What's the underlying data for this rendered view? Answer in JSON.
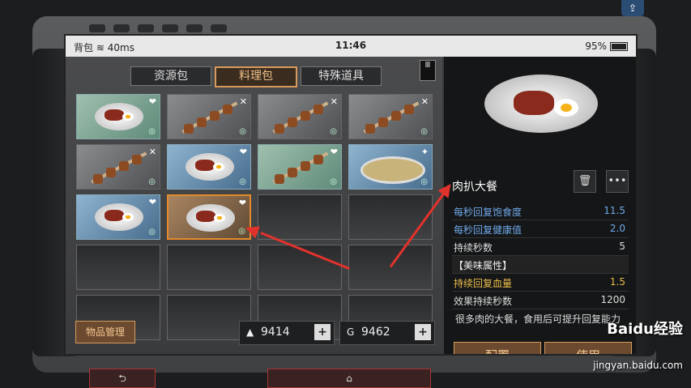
{
  "status": {
    "carrier": "背包",
    "signal": "40ms",
    "time": "11:46",
    "battery": "95%"
  },
  "tabs": [
    {
      "label": "资源包"
    },
    {
      "label": "料理包"
    },
    {
      "label": "特殊道具"
    }
  ],
  "marker": "Ⅲ",
  "slots": [
    {
      "type": "steak",
      "bg": "green",
      "tag": "❤"
    },
    {
      "type": "skewer",
      "bg": "gray",
      "tag": "✕"
    },
    {
      "type": "skewer",
      "bg": "gray",
      "tag": "✕"
    },
    {
      "type": "skewer",
      "bg": "gray",
      "tag": "✕"
    },
    {
      "type": "skewer",
      "bg": "gray",
      "tag": "✕"
    },
    {
      "type": "steak",
      "bg": "blue",
      "tag": "❤"
    },
    {
      "type": "skewer",
      "bg": "green",
      "tag": "❤"
    },
    {
      "type": "fish",
      "bg": "blue",
      "tag": "✦"
    },
    {
      "type": "steak",
      "bg": "blue",
      "tag": "❤"
    },
    {
      "type": "steak",
      "bg": "orange",
      "tag": "❤"
    },
    {
      "type": "empty"
    },
    {
      "type": "empty"
    },
    {
      "type": "empty"
    },
    {
      "type": "empty"
    },
    {
      "type": "empty"
    },
    {
      "type": "empty"
    },
    {
      "type": "empty"
    },
    {
      "type": "empty"
    },
    {
      "type": "empty"
    },
    {
      "type": "empty"
    }
  ],
  "manage_label": "物品管理",
  "currency": [
    {
      "icon": "▲",
      "value": "9414",
      "plus": "+"
    },
    {
      "icon": "G",
      "value": "9462",
      "plus": "+"
    }
  ],
  "detail": {
    "name": "肉扒大餐",
    "delete_icon": "🗑",
    "more_icon": "•••",
    "rows": [
      {
        "k": "每秒回复饱食度",
        "v": "11.5",
        "style": "blue"
      },
      {
        "k": "每秒回复健康值",
        "v": "2.0",
        "style": "blue"
      },
      {
        "k": "持续秒数",
        "v": "5",
        "style": ""
      },
      {
        "k": "【美味属性】",
        "v": "",
        "style": "header"
      },
      {
        "k": "持续回复血量",
        "v": "1.5",
        "style": "gold"
      },
      {
        "k": "效果持续秒数",
        "v": "1200",
        "style": ""
      }
    ],
    "description": "很多肉的大餐，食用后可提升回复能力",
    "config_label": "配置",
    "use_label": "使用"
  },
  "nav": {
    "back": "⮌",
    "home": "⌂",
    "top_corner": "⇪"
  },
  "watermark": {
    "brand": "Baidu经验",
    "url": "jingyan.baidu.com"
  }
}
